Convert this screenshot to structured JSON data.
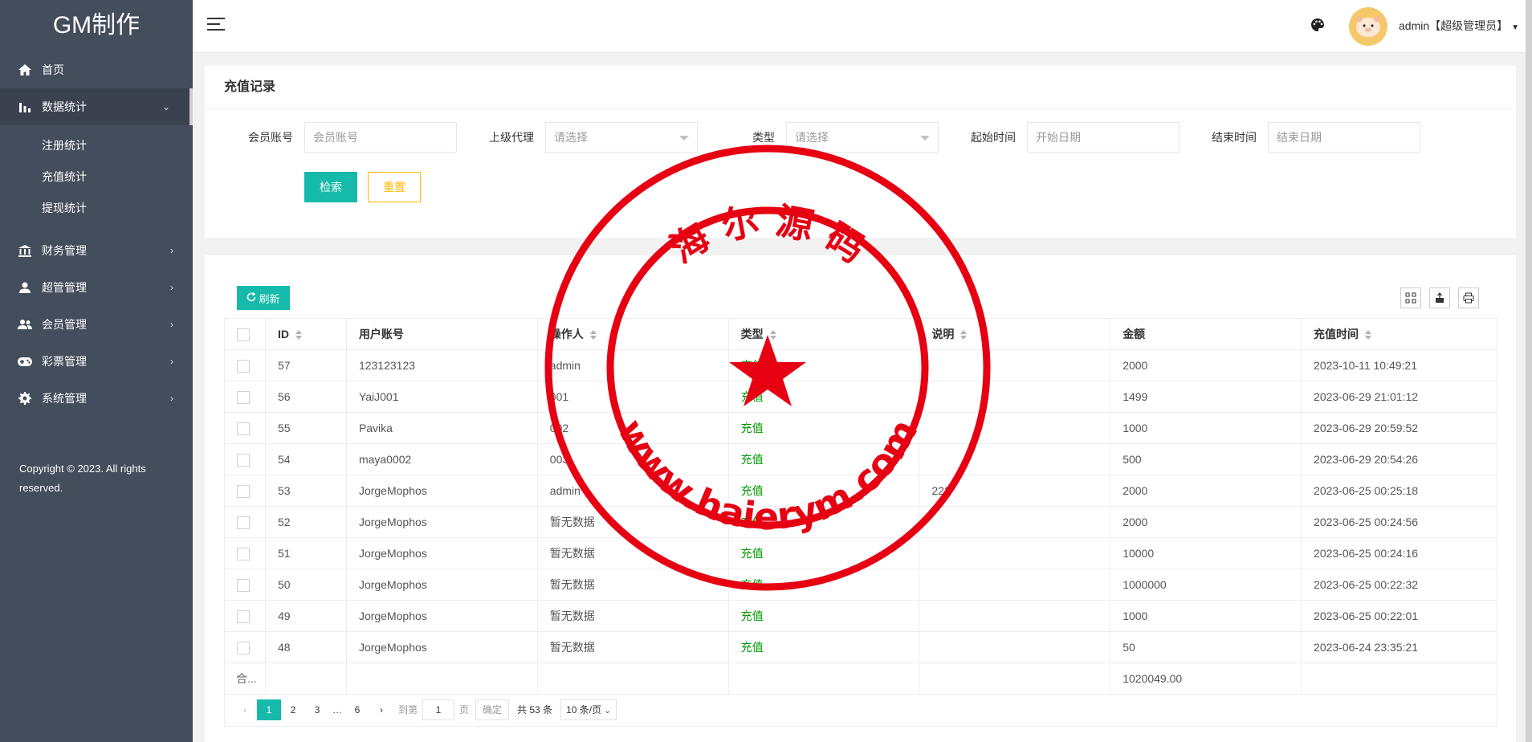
{
  "app": {
    "logo": "GM制作"
  },
  "sidebar": {
    "items": [
      {
        "id": "home",
        "label": "首页",
        "icon": "home-icon"
      },
      {
        "id": "stats",
        "label": "数据统计",
        "icon": "bar-chart-icon",
        "expanded": true,
        "children": [
          "注册统计",
          "充值统计",
          "提现统计"
        ]
      },
      {
        "id": "finance",
        "label": "财务管理",
        "icon": "bank-icon"
      },
      {
        "id": "admin",
        "label": "超管管理",
        "icon": "user-icon"
      },
      {
        "id": "members",
        "label": "会员管理",
        "icon": "users-icon"
      },
      {
        "id": "lottery",
        "label": "彩票管理",
        "icon": "gamepad-icon"
      },
      {
        "id": "system",
        "label": "系统管理",
        "icon": "gear-icon"
      }
    ],
    "copyright": "Copyright © 2023. All rights reserved."
  },
  "header": {
    "user": "admin【超级管理员】"
  },
  "search": {
    "title": "充值记录",
    "fields": {
      "account_label": "会员账号",
      "account_placeholder": "会员账号",
      "agent_label": "上级代理",
      "agent_placeholder": "请选择",
      "type_label": "类型",
      "type_placeholder": "请选择",
      "start_label": "起始时间",
      "start_placeholder": "开始日期",
      "end_label": "结束时间",
      "end_placeholder": "结束日期"
    },
    "search_btn": "检索",
    "reset_btn": "重置"
  },
  "table": {
    "refresh_btn": "刷新",
    "columns": [
      "ID",
      "用户账号",
      "操作人",
      "类型",
      "说明",
      "金额",
      "充值时间"
    ],
    "rows": [
      {
        "id": "57",
        "account": "123123123",
        "operator": "admin",
        "type": "充值",
        "note": "",
        "amount": "2000",
        "time": "2023-10-11 10:49:21"
      },
      {
        "id": "56",
        "account": "YaiJ001",
        "operator": "001",
        "type": "充值",
        "note": "",
        "amount": "1499",
        "time": "2023-06-29 21:01:12"
      },
      {
        "id": "55",
        "account": "Pavika",
        "operator": "002",
        "type": "充值",
        "note": "",
        "amount": "1000",
        "time": "2023-06-29 20:59:52"
      },
      {
        "id": "54",
        "account": "maya0002",
        "operator": "003",
        "type": "充值",
        "note": "",
        "amount": "500",
        "time": "2023-06-29 20:54:26"
      },
      {
        "id": "53",
        "account": "JorgeMophos",
        "operator": "admin",
        "type": "充值",
        "note": "222",
        "amount": "2000",
        "time": "2023-06-25 00:25:18"
      },
      {
        "id": "52",
        "account": "JorgeMophos",
        "operator": "暂无数据",
        "type": "充值",
        "note": "",
        "amount": "2000",
        "time": "2023-06-25 00:24:56"
      },
      {
        "id": "51",
        "account": "JorgeMophos",
        "operator": "暂无数据",
        "type": "充值",
        "note": "",
        "amount": "10000",
        "time": "2023-06-25 00:24:16"
      },
      {
        "id": "50",
        "account": "JorgeMophos",
        "operator": "暂无数据",
        "type": "充值",
        "note": "",
        "amount": "1000000",
        "time": "2023-06-25 00:22:32"
      },
      {
        "id": "49",
        "account": "JorgeMophos",
        "operator": "暂无数据",
        "type": "充值",
        "note": "",
        "amount": "1000",
        "time": "2023-06-25 00:22:01"
      },
      {
        "id": "48",
        "account": "JorgeMophos",
        "operator": "暂无数据",
        "type": "充值",
        "note": "",
        "amount": "50",
        "time": "2023-06-24 23:35:21"
      }
    ],
    "total_label": "合...",
    "total_amount": "1020049.00"
  },
  "pager": {
    "pages": [
      "1",
      "2",
      "3",
      "…",
      "6"
    ],
    "current": "1",
    "goto_label": "到第",
    "goto_value": "1",
    "page_unit": "页",
    "confirm": "确定",
    "total": "共 53 条",
    "page_size": "10 条/页"
  },
  "watermark": {
    "top_text": "海 尔 源 码",
    "bottom_text": "www.haierym.com",
    "color": "#e60012"
  }
}
